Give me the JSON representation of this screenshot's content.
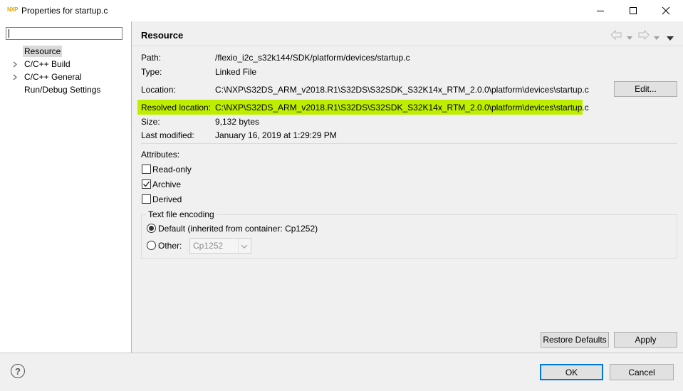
{
  "window": {
    "title": "Properties for startup.c",
    "logo_text": "NXP"
  },
  "sidebar": {
    "filter_value": "",
    "items": [
      {
        "label": "Resource",
        "selected": true,
        "expandable": false
      },
      {
        "label": "C/C++ Build",
        "selected": false,
        "expandable": true
      },
      {
        "label": "C/C++ General",
        "selected": false,
        "expandable": true
      },
      {
        "label": "Run/Debug Settings",
        "selected": false,
        "expandable": false
      }
    ]
  },
  "page": {
    "title": "Resource",
    "path_label": "Path:",
    "path_value": "/flexio_i2c_s32k144/SDK/platform/devices/startup.c",
    "type_label": "Type:",
    "type_value": "Linked File",
    "location_label": "Location:",
    "location_value": "C:\\NXP\\S32DS_ARM_v2018.R1\\S32DS\\S32SDK_S32K14x_RTM_2.0.0\\platform\\devices\\startup.c",
    "edit_label": "Edit...",
    "resolved_label": "Resolved location:",
    "resolved_value": "C:\\NXP\\S32DS_ARM_v2018.R1\\S32DS\\S32SDK_S32K14x_RTM_2.0.0\\platform\\devices\\startup.c",
    "size_label": "Size:",
    "size_value": "9,132  bytes",
    "modified_label": "Last modified:",
    "modified_value": "January 16, 2019 at 1:29:29 PM",
    "attributes_label": "Attributes:",
    "attributes": [
      {
        "label": "Read-only",
        "checked": false
      },
      {
        "label": "Archive",
        "checked": true
      },
      {
        "label": "Derived",
        "checked": false
      }
    ],
    "encoding": {
      "group_label": "Text file encoding",
      "default_label": "Default (inherited from container: Cp1252)",
      "other_label": "Other:",
      "other_value": "Cp1252",
      "selected": "default"
    },
    "restore_defaults_label": "Restore Defaults",
    "apply_label": "Apply",
    "highlight_color": "#bfee00"
  },
  "footer": {
    "help_symbol": "?",
    "ok_label": "OK",
    "cancel_label": "Cancel"
  }
}
